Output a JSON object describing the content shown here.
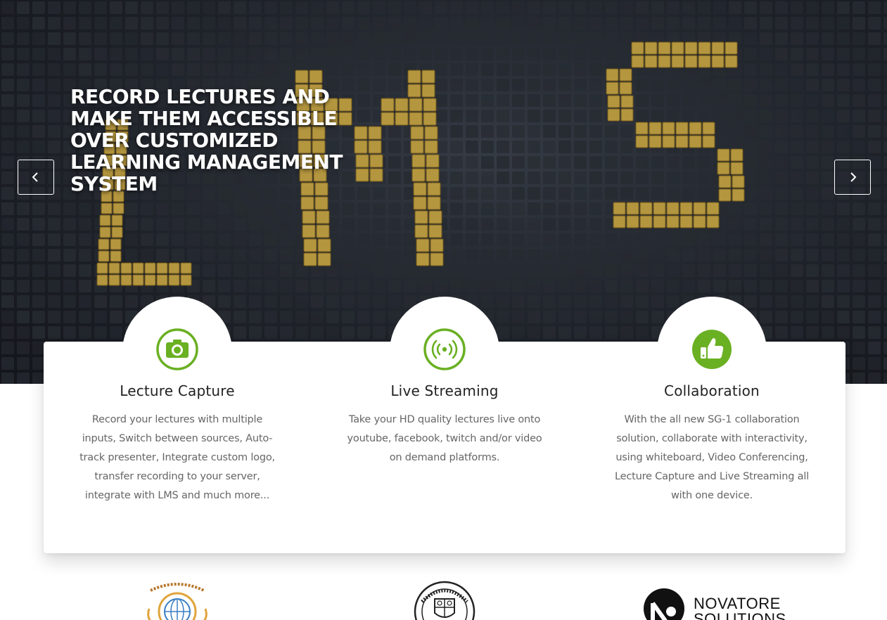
{
  "hero": {
    "title": "RECORD LECTURES AND MAKE THEM ACCESSIBLE OVER CUSTOMIZED LEARNING MANAGEMENT SYSTEM",
    "image_text": "LMS",
    "prev_icon": "chevron-left-icon",
    "next_icon": "chevron-right-icon"
  },
  "colors": {
    "accent": "#6ab023",
    "title_text": "#222222",
    "body_text": "#666666",
    "hero_cube_gold": "#d9b54a",
    "hero_cube_dark": "#2d3239"
  },
  "features": [
    {
      "icon": "camera-icon",
      "title": "Lecture Capture",
      "lines": [
        "Record your lectures with multiple",
        "inputs, Switch between sources, Auto-",
        "track presenter, Integrate custom logo,",
        "transfer recording to your server,",
        "integrate with LMS and much more..."
      ]
    },
    {
      "icon": "broadcast-icon",
      "title": "Live Streaming",
      "lines": [
        "Take your HD quality lectures live onto",
        "youtube, facebook, twitch and/or video",
        "on demand platforms."
      ]
    },
    {
      "icon": "thumbs-up-icon",
      "title": "Collaboration",
      "lines": [
        "With the all new SG-1 collaboration",
        "solution, collaborate with interactivity,",
        "using whiteboard, Video Conferencing,",
        "Lecture Capture and Live Streaming all",
        "with one device."
      ]
    }
  ],
  "partners": {
    "logo3_lines": [
      "NOVATORE",
      "SOLUTIONS"
    ]
  }
}
